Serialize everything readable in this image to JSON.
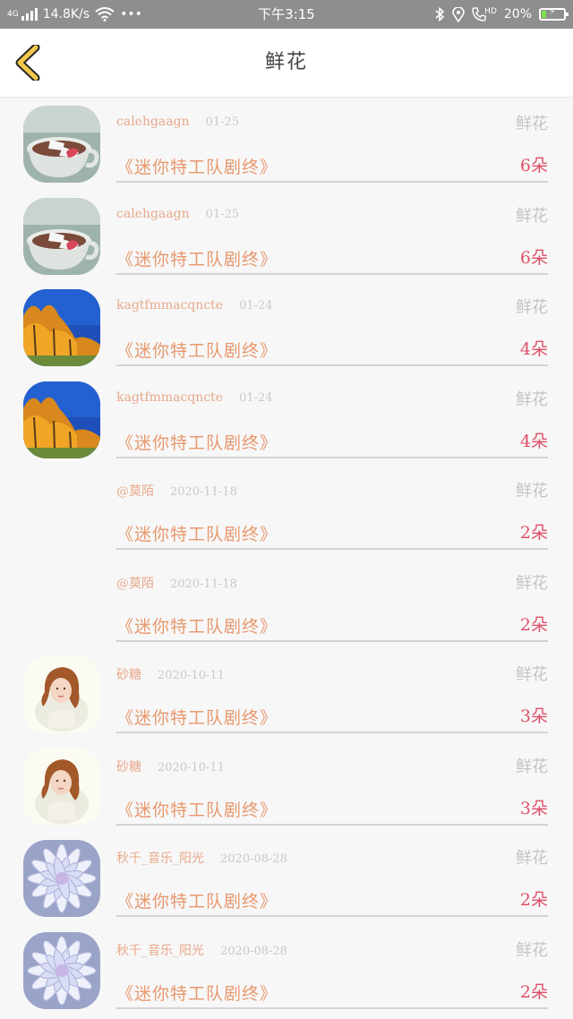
{
  "status_bar": {
    "network": "4G",
    "speed": "14.8K/s",
    "more": "•••",
    "time": "下午3:15",
    "call_tag": "HD",
    "battery": "20%",
    "battery_level": 0.2,
    "battery_color": "#7ee04a"
  },
  "header": {
    "title": "鲜花",
    "back_icon": "chevron-left-icon",
    "accent": "#f2c94c"
  },
  "records": [
    {
      "user": "calehgaagn",
      "date": "01-25",
      "gift": "鲜花",
      "book": "《迷你特工队剧终》",
      "count": "6朵",
      "avatar": "coffee"
    },
    {
      "user": "calehgaagn",
      "date": "01-25",
      "gift": "鲜花",
      "book": "《迷你特工队剧终》",
      "count": "6朵",
      "avatar": "coffee"
    },
    {
      "user": "kagtfmmacqncte",
      "date": "01-24",
      "gift": "鲜花",
      "book": "《迷你特工队剧终》",
      "count": "4朵",
      "avatar": "autumn"
    },
    {
      "user": "kagtfmmacqncte",
      "date": "01-24",
      "gift": "鲜花",
      "book": "《迷你特工队剧终》",
      "count": "4朵",
      "avatar": "autumn"
    },
    {
      "user": "@莫陌",
      "date": "2020-11-18",
      "gift": "鲜花",
      "book": "《迷你特工队剧终》",
      "count": "2朵",
      "avatar": "none"
    },
    {
      "user": "@莫陌",
      "date": "2020-11-18",
      "gift": "鲜花",
      "book": "《迷你特工队剧终》",
      "count": "2朵",
      "avatar": "none"
    },
    {
      "user": "砂糖",
      "date": "2020-10-11",
      "gift": "鲜花",
      "book": "《迷你特工队剧终》",
      "count": "3朵",
      "avatar": "girl"
    },
    {
      "user": "砂糖",
      "date": "2020-10-11",
      "gift": "鲜花",
      "book": "《迷你特工队剧终》",
      "count": "3朵",
      "avatar": "girl"
    },
    {
      "user": "秋千_音乐_阳光",
      "date": "2020-08-28",
      "gift": "鲜花",
      "book": "《迷你特工队剧终》",
      "count": "2朵",
      "avatar": "flower"
    },
    {
      "user": "秋千_音乐_阳光",
      "date": "2020-08-28",
      "gift": "鲜花",
      "book": "《迷你特工队剧终》",
      "count": "2朵",
      "avatar": "flower"
    }
  ]
}
